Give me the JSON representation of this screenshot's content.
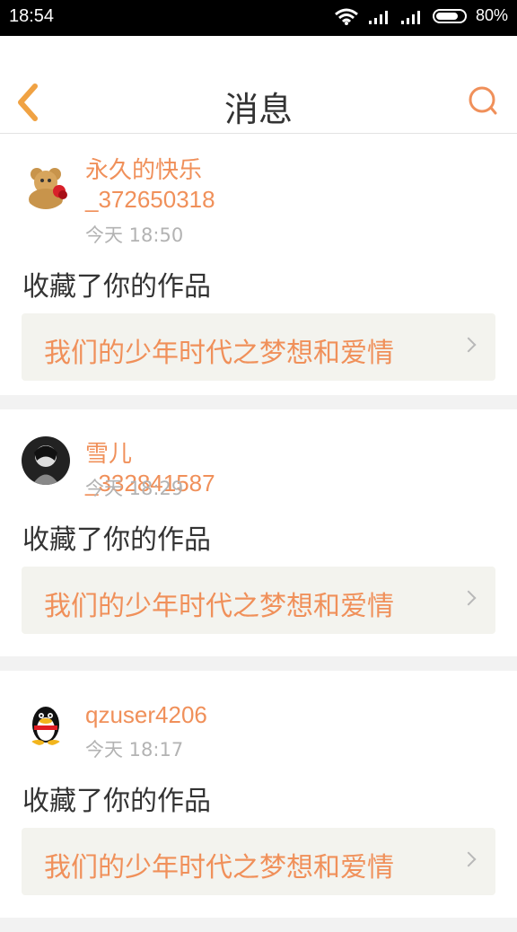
{
  "status_bar": {
    "time": "18:54",
    "battery": "80%",
    "battery_level": 0.8
  },
  "nav": {
    "title": "消息",
    "back_icon": "chevron-left-icon",
    "search_icon": "search-icon"
  },
  "colors": {
    "accent": "#f0905a",
    "text": "#333333",
    "muted": "#b3b3b3"
  },
  "messages": [
    {
      "user": "永久的快乐_372650318",
      "time": "今天 18:50",
      "action": "收藏了你的作品",
      "work": "我们的少年时代之梦想和爱情"
    },
    {
      "user": "雪儿_332841587",
      "time": "今天 18:29",
      "action": "收藏了你的作品",
      "work": "我们的少年时代之梦想和爱情"
    },
    {
      "user": "qzuser4206",
      "time": "今天 18:17",
      "action": "收藏了你的作品",
      "work": "我们的少年时代之梦想和爱情"
    }
  ]
}
